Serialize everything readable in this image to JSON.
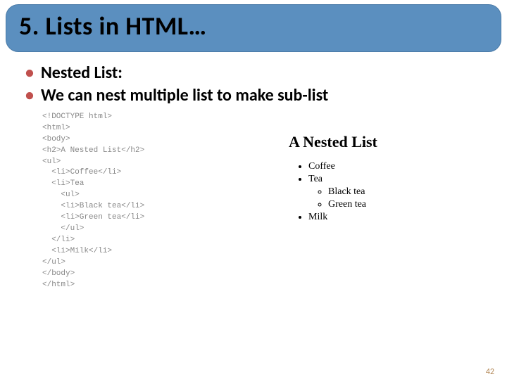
{
  "title": "5. Lists in HTML…",
  "bullets": [
    "Nested List:",
    "We can nest multiple list to make sub-list"
  ],
  "code_lines": [
    "<!DOCTYPE html>",
    "<html>",
    "<body>",
    "",
    "<h2>A Nested List</h2>",
    "",
    "<ul>",
    "  <li>Coffee</li>",
    "  <li>Tea",
    "    <ul>",
    "    <li>Black tea</li>",
    "    <li>Green tea</li>",
    "    </ul>",
    "  </li>",
    "  <li>Milk</li>",
    "</ul>",
    "",
    "</body>",
    "</html>"
  ],
  "rendered": {
    "heading": "A Nested List",
    "items": [
      {
        "label": "Coffee",
        "children": []
      },
      {
        "label": "Tea",
        "children": [
          "Black tea",
          "Green tea"
        ]
      },
      {
        "label": "Milk",
        "children": []
      }
    ]
  },
  "page_number": "42"
}
